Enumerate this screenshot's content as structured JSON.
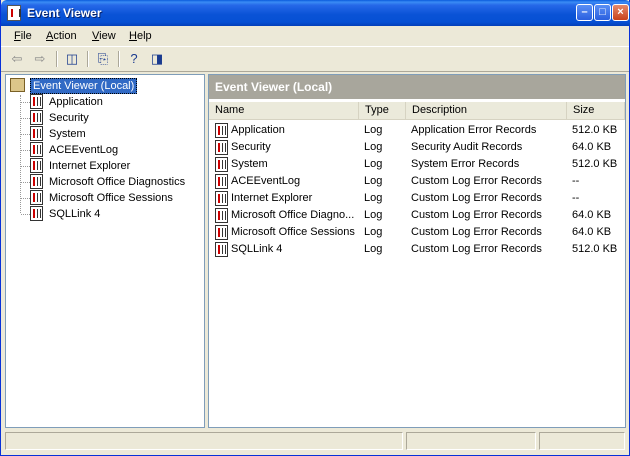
{
  "window": {
    "title": "Event Viewer"
  },
  "menu": [
    {
      "label": "File",
      "ul": "F",
      "rest": "ile"
    },
    {
      "label": "Action",
      "ul": "A",
      "rest": "ction"
    },
    {
      "label": "View",
      "ul": "V",
      "rest": "iew"
    },
    {
      "label": "Help",
      "ul": "H",
      "rest": "elp"
    }
  ],
  "tree": {
    "root": "Event Viewer (Local)",
    "items": [
      "Application",
      "Security",
      "System",
      "ACEEventLog",
      "Internet Explorer",
      "Microsoft Office Diagnostics",
      "Microsoft Office Sessions",
      "SQLLink 4"
    ]
  },
  "pane": {
    "header": "Event Viewer (Local)",
    "columns": [
      "Name",
      "Type",
      "Description",
      "Size"
    ],
    "rows": [
      {
        "name": "Application",
        "type": "Log",
        "description": "Application Error Records",
        "size": "512.0 KB"
      },
      {
        "name": "Security",
        "type": "Log",
        "description": "Security Audit Records",
        "size": "64.0 KB"
      },
      {
        "name": "System",
        "type": "Log",
        "description": "System Error Records",
        "size": "512.0 KB"
      },
      {
        "name": "ACEEventLog",
        "type": "Log",
        "description": "Custom Log Error Records",
        "size": "--"
      },
      {
        "name": "Internet Explorer",
        "type": "Log",
        "description": "Custom Log Error Records",
        "size": "--"
      },
      {
        "name": "Microsoft Office Diagno...",
        "type": "Log",
        "description": "Custom Log Error Records",
        "size": "64.0 KB"
      },
      {
        "name": "Microsoft Office Sessions",
        "type": "Log",
        "description": "Custom Log Error Records",
        "size": "64.0 KB"
      },
      {
        "name": "SQLLink 4",
        "type": "Log",
        "description": "Custom Log Error Records",
        "size": "512.0 KB"
      }
    ]
  }
}
